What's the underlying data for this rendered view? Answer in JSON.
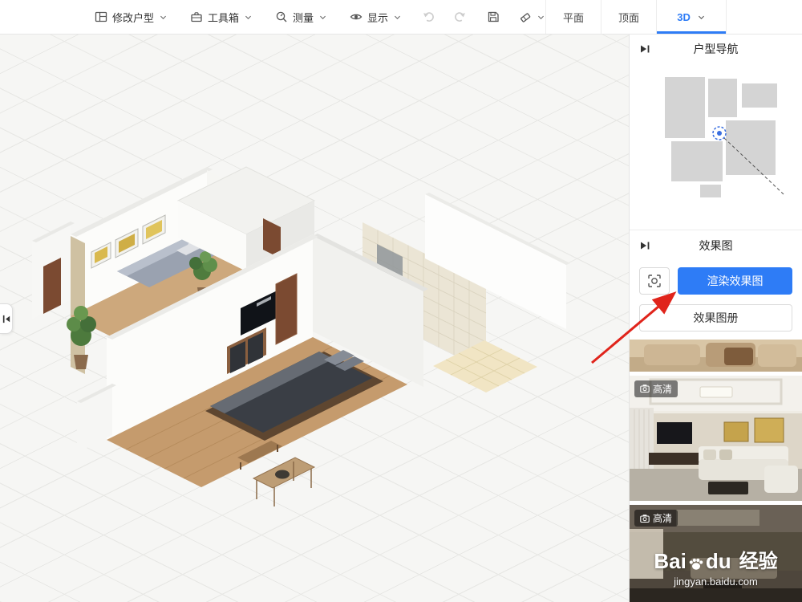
{
  "toolbar": {
    "menus": [
      {
        "label": "修改户型"
      },
      {
        "label": "工具箱"
      },
      {
        "label": "测量"
      },
      {
        "label": "显示"
      }
    ],
    "view_tabs": [
      {
        "label": "平面"
      },
      {
        "label": "顶面"
      },
      {
        "label": "3D"
      }
    ]
  },
  "sidebar": {
    "floorplan_nav": {
      "title": "户型导航"
    },
    "effects": {
      "title": "效果图",
      "render_button_label": "渲染效果图",
      "album_button_label": "效果图册",
      "hd_badge_label": "高清"
    },
    "watermark": {
      "brand_left": "Bai",
      "brand_right": "du",
      "suffix": "经验",
      "url": "jingyan.baidu.com"
    }
  },
  "colors": {
    "accent_blue": "#2e7cf6",
    "arrow_red": "#e0241b"
  }
}
